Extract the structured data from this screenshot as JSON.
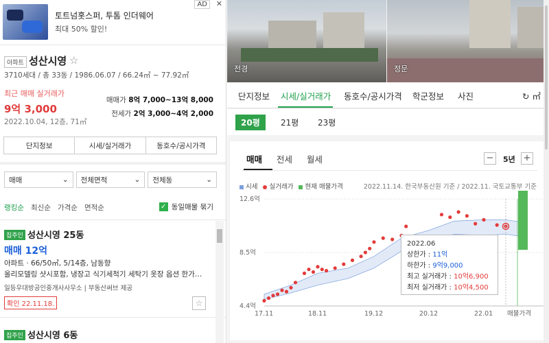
{
  "ad": {
    "title": "토트넘홋스퍼, 투톰 인더웨어",
    "subtitle": "최대 50% 할인!",
    "badge": "AD",
    "close": "✕"
  },
  "complex": {
    "tag": "아파트",
    "name": "성산시영",
    "info": "3710세대 / 총 33동 / 1986.06.07 / 66.24㎡ ~ 77.92㎡",
    "recent_label": "최근 매매 실거래가",
    "recent_price": "9억 3,000",
    "recent_date": "2022.10.04, 12층, 71㎡",
    "sale_label": "매매가",
    "sale_range": "8억 7,000~13억 8,000",
    "jeonse_label": "전세가",
    "jeonse_range": "2억 3,000~4억 2,000",
    "tabs": [
      "단지정보",
      "시세/실거래가",
      "동호수/공시가격"
    ]
  },
  "filters": {
    "trade": "매매",
    "area": "전체면적",
    "dong": "전체동",
    "sort": [
      "랭킹순",
      "최신순",
      "가격순",
      "면적순"
    ],
    "same_label": "동일매물 묶기"
  },
  "listings": [
    {
      "badge": "집주인",
      "title": "성산시영 25동",
      "price": "매매 12억",
      "spec": "아파트 · 66/50㎡, 5/14층, 남동향",
      "desc": "올리모델링 샷시포함, 냉장고 식기세척기 세탁기 옷장 옵션 한가…",
      "agent": "일등우대방공인중개사사무소 | 부동산써브 제공",
      "confirm": "확인 22.11.18."
    },
    {
      "badge": "집주인",
      "title": "성산시영 6동"
    }
  ],
  "photos": {
    "left_caption": "전경",
    "right_caption": "정문"
  },
  "nav": {
    "tabs": [
      "단지정보",
      "시세/실거래가",
      "동호수/공시가격",
      "학군정보",
      "사진"
    ],
    "active": "시세/실거래가",
    "unit": "↻ ㎡"
  },
  "sizes": {
    "items": [
      "20평",
      "21평",
      "23평"
    ],
    "active": "20평"
  },
  "panel": {
    "tabs": [
      "매매",
      "전세",
      "월세"
    ],
    "active": "매매",
    "period": "5년",
    "minus": "−",
    "plus": "+",
    "legend": [
      "시세",
      "실거래가",
      "현재 매물가격"
    ],
    "source": "2022.11.14. 한국부동산원 기준 / 2022.11. 국토교통부 기준",
    "tooltip": {
      "date": "2022.06",
      "upper_label": "상한가 :",
      "upper": "11억",
      "lower_label": "하한가 :",
      "lower": "9억9,000",
      "max_label": "최고 실거래가 :",
      "max": "10억6,900",
      "min_label": "최저 실거래가 :",
      "min": "10억4,500"
    }
  },
  "colors": {
    "accent": "#1fa04c",
    "price_red": "#e23b3b",
    "listing_blue": "#1b5fd9",
    "market_band": "#7b9fdc",
    "current_listing": "#55b85a"
  },
  "chart_data": {
    "type": "scatter",
    "yaxis_ticks": [
      "12.6억",
      "8.5억",
      "4.4억"
    ],
    "xaxis_ticks": [
      "17.11",
      "18.11",
      "19.12",
      "20.12",
      "22.01",
      "매물가격"
    ],
    "ylim": [
      4.4,
      12.6
    ],
    "ylabel": "",
    "xlabel": "",
    "series": [
      {
        "name": "시세",
        "x": [
          "17.11",
          "18.05",
          "18.11",
          "19.06",
          "19.12",
          "20.06",
          "20.12",
          "21.06",
          "22.01",
          "22.06",
          "22.10"
        ],
        "upper": [
          5.3,
          6.0,
          6.9,
          7.3,
          8.2,
          9.6,
          10.2,
          10.9,
          11.0,
          11.0,
          10.8
        ],
        "lower": [
          4.9,
          5.4,
          6.0,
          6.5,
          7.3,
          8.6,
          9.4,
          9.9,
          9.8,
          9.9,
          9.7
        ]
      },
      {
        "name": "실거래가",
        "x": [
          "17.11",
          "17.12",
          "18.01",
          "18.02",
          "18.03",
          "18.04",
          "18.05",
          "18.06",
          "18.08",
          "18.09",
          "18.10",
          "18.11",
          "18.12",
          "19.01",
          "19.03",
          "19.05",
          "19.07",
          "19.09",
          "19.10",
          "19.11",
          "19.12",
          "20.02",
          "20.04",
          "20.06",
          "20.07",
          "21.03",
          "21.05",
          "21.07",
          "21.09",
          "21.11",
          "22.01",
          "22.04",
          "22.06",
          "22.10"
        ],
        "values": [
          4.8,
          5.0,
          5.2,
          5.3,
          5.6,
          5.5,
          5.8,
          6.2,
          6.9,
          7.2,
          7.0,
          7.4,
          7.2,
          7.1,
          7.3,
          7.6,
          7.9,
          8.2,
          8.5,
          8.8,
          9.3,
          9.6,
          9.5,
          9.8,
          10.5,
          11.4,
          11.2,
          11.6,
          11.3,
          10.7,
          11.0,
          10.6,
          10.5,
          10.3
        ]
      },
      {
        "name": "현재 매물가격",
        "range": [
          8.7,
          13.8
        ]
      }
    ]
  }
}
